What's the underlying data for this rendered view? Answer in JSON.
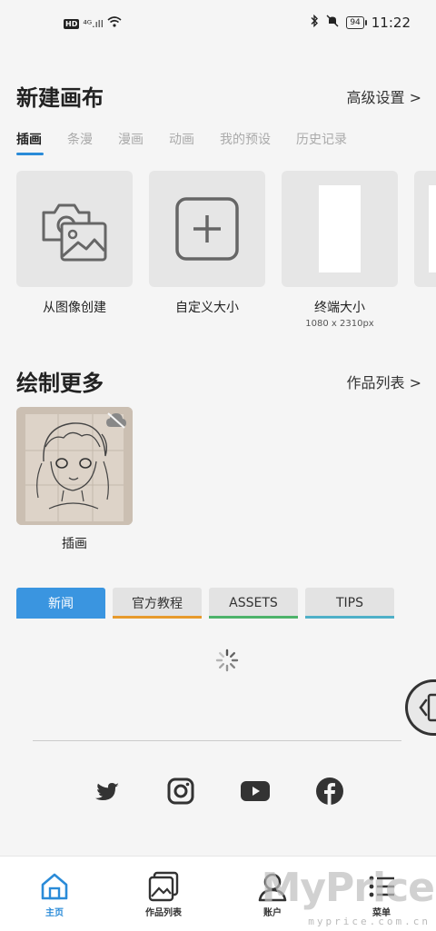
{
  "status_bar": {
    "hd": "HD",
    "signal": "⁴ᴳ.ıll",
    "time": "11:22",
    "battery": "94"
  },
  "new_canvas": {
    "title": "新建画布",
    "advanced_link": "高级设置 >",
    "tabs": [
      {
        "label": "插画",
        "active": true
      },
      {
        "label": "条漫"
      },
      {
        "label": "漫画"
      },
      {
        "label": "动画"
      },
      {
        "label": "我的预设"
      },
      {
        "label": "历史记录"
      }
    ],
    "cards": [
      {
        "label": "从图像创建",
        "icon": "camera-image-icon"
      },
      {
        "label": "自定义大小",
        "icon": "plus-square-icon"
      },
      {
        "label": "终端大小",
        "sub": "1080 x 2310px",
        "icon": "portrait-canvas-icon"
      }
    ]
  },
  "draw_more": {
    "title": "绘制更多",
    "works_link": "作品列表 >",
    "artwork_label": "插画"
  },
  "news_tabs": [
    {
      "label": "新闻",
      "color": "#3a95e0"
    },
    {
      "label": "官方教程",
      "color": "#e79a2c"
    },
    {
      "label": "ASSETS",
      "color": "#4db36a"
    },
    {
      "label": "TIPS",
      "color": "#4fb0c8"
    }
  ],
  "bottom_nav": [
    {
      "label": "主页",
      "icon": "home-icon"
    },
    {
      "label": "作品列表",
      "icon": "gallery-icon"
    },
    {
      "label": "账户",
      "icon": "account-icon"
    },
    {
      "label": "菜单",
      "icon": "menu-icon"
    }
  ],
  "watermark": {
    "main": "MyPrice",
    "sub": "myprice.com.cn"
  },
  "colors": {
    "accent": "#2a8bd8",
    "tile": "#e6e6e6",
    "background": "#f5f5f5"
  }
}
